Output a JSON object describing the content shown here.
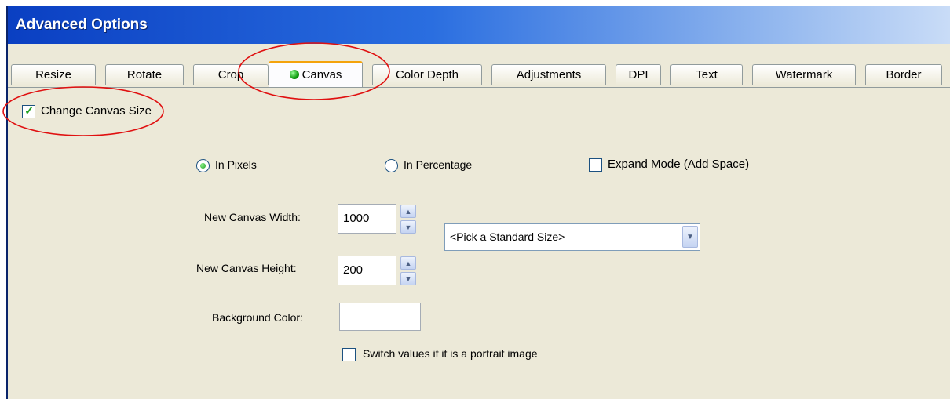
{
  "window": {
    "title": "Advanced Options"
  },
  "tabs": [
    {
      "label": "Resize"
    },
    {
      "label": "Rotate"
    },
    {
      "label": "Crop"
    },
    {
      "label": "Canvas",
      "active": true
    },
    {
      "label": "Color Depth"
    },
    {
      "label": "Adjustments"
    },
    {
      "label": "DPI"
    },
    {
      "label": "Text"
    },
    {
      "label": "Watermark"
    },
    {
      "label": "Border"
    }
  ],
  "canvas": {
    "change_canvas_size": {
      "label": "Change Canvas Size",
      "checked": true
    },
    "mode": {
      "pixels_label": "In Pixels",
      "percentage_label": "In Percentage",
      "selected": "In Pixels"
    },
    "expand_mode": {
      "label": "Expand Mode (Add Space)",
      "checked": false
    },
    "width": {
      "label": "New Canvas Width:",
      "value": "1000"
    },
    "height": {
      "label": "New Canvas Height:",
      "value": "200"
    },
    "standard_size": {
      "selected": "<Pick a Standard Size>"
    },
    "background_color": {
      "label": "Background Color:",
      "value": ""
    },
    "switch_portrait": {
      "label": "Switch values if it is a portrait image",
      "checked": false
    }
  },
  "colors": {
    "title_bar": "#0a3fc2",
    "active_tab_accent": "#f4a30b",
    "annotation": "#e01010",
    "checkmark": "#21a121"
  },
  "icons": {
    "canvas_tab": "green-dot-icon",
    "spin_up": "arrow-up-icon",
    "spin_down": "arrow-down-icon",
    "dropdown": "chevron-down-icon"
  }
}
